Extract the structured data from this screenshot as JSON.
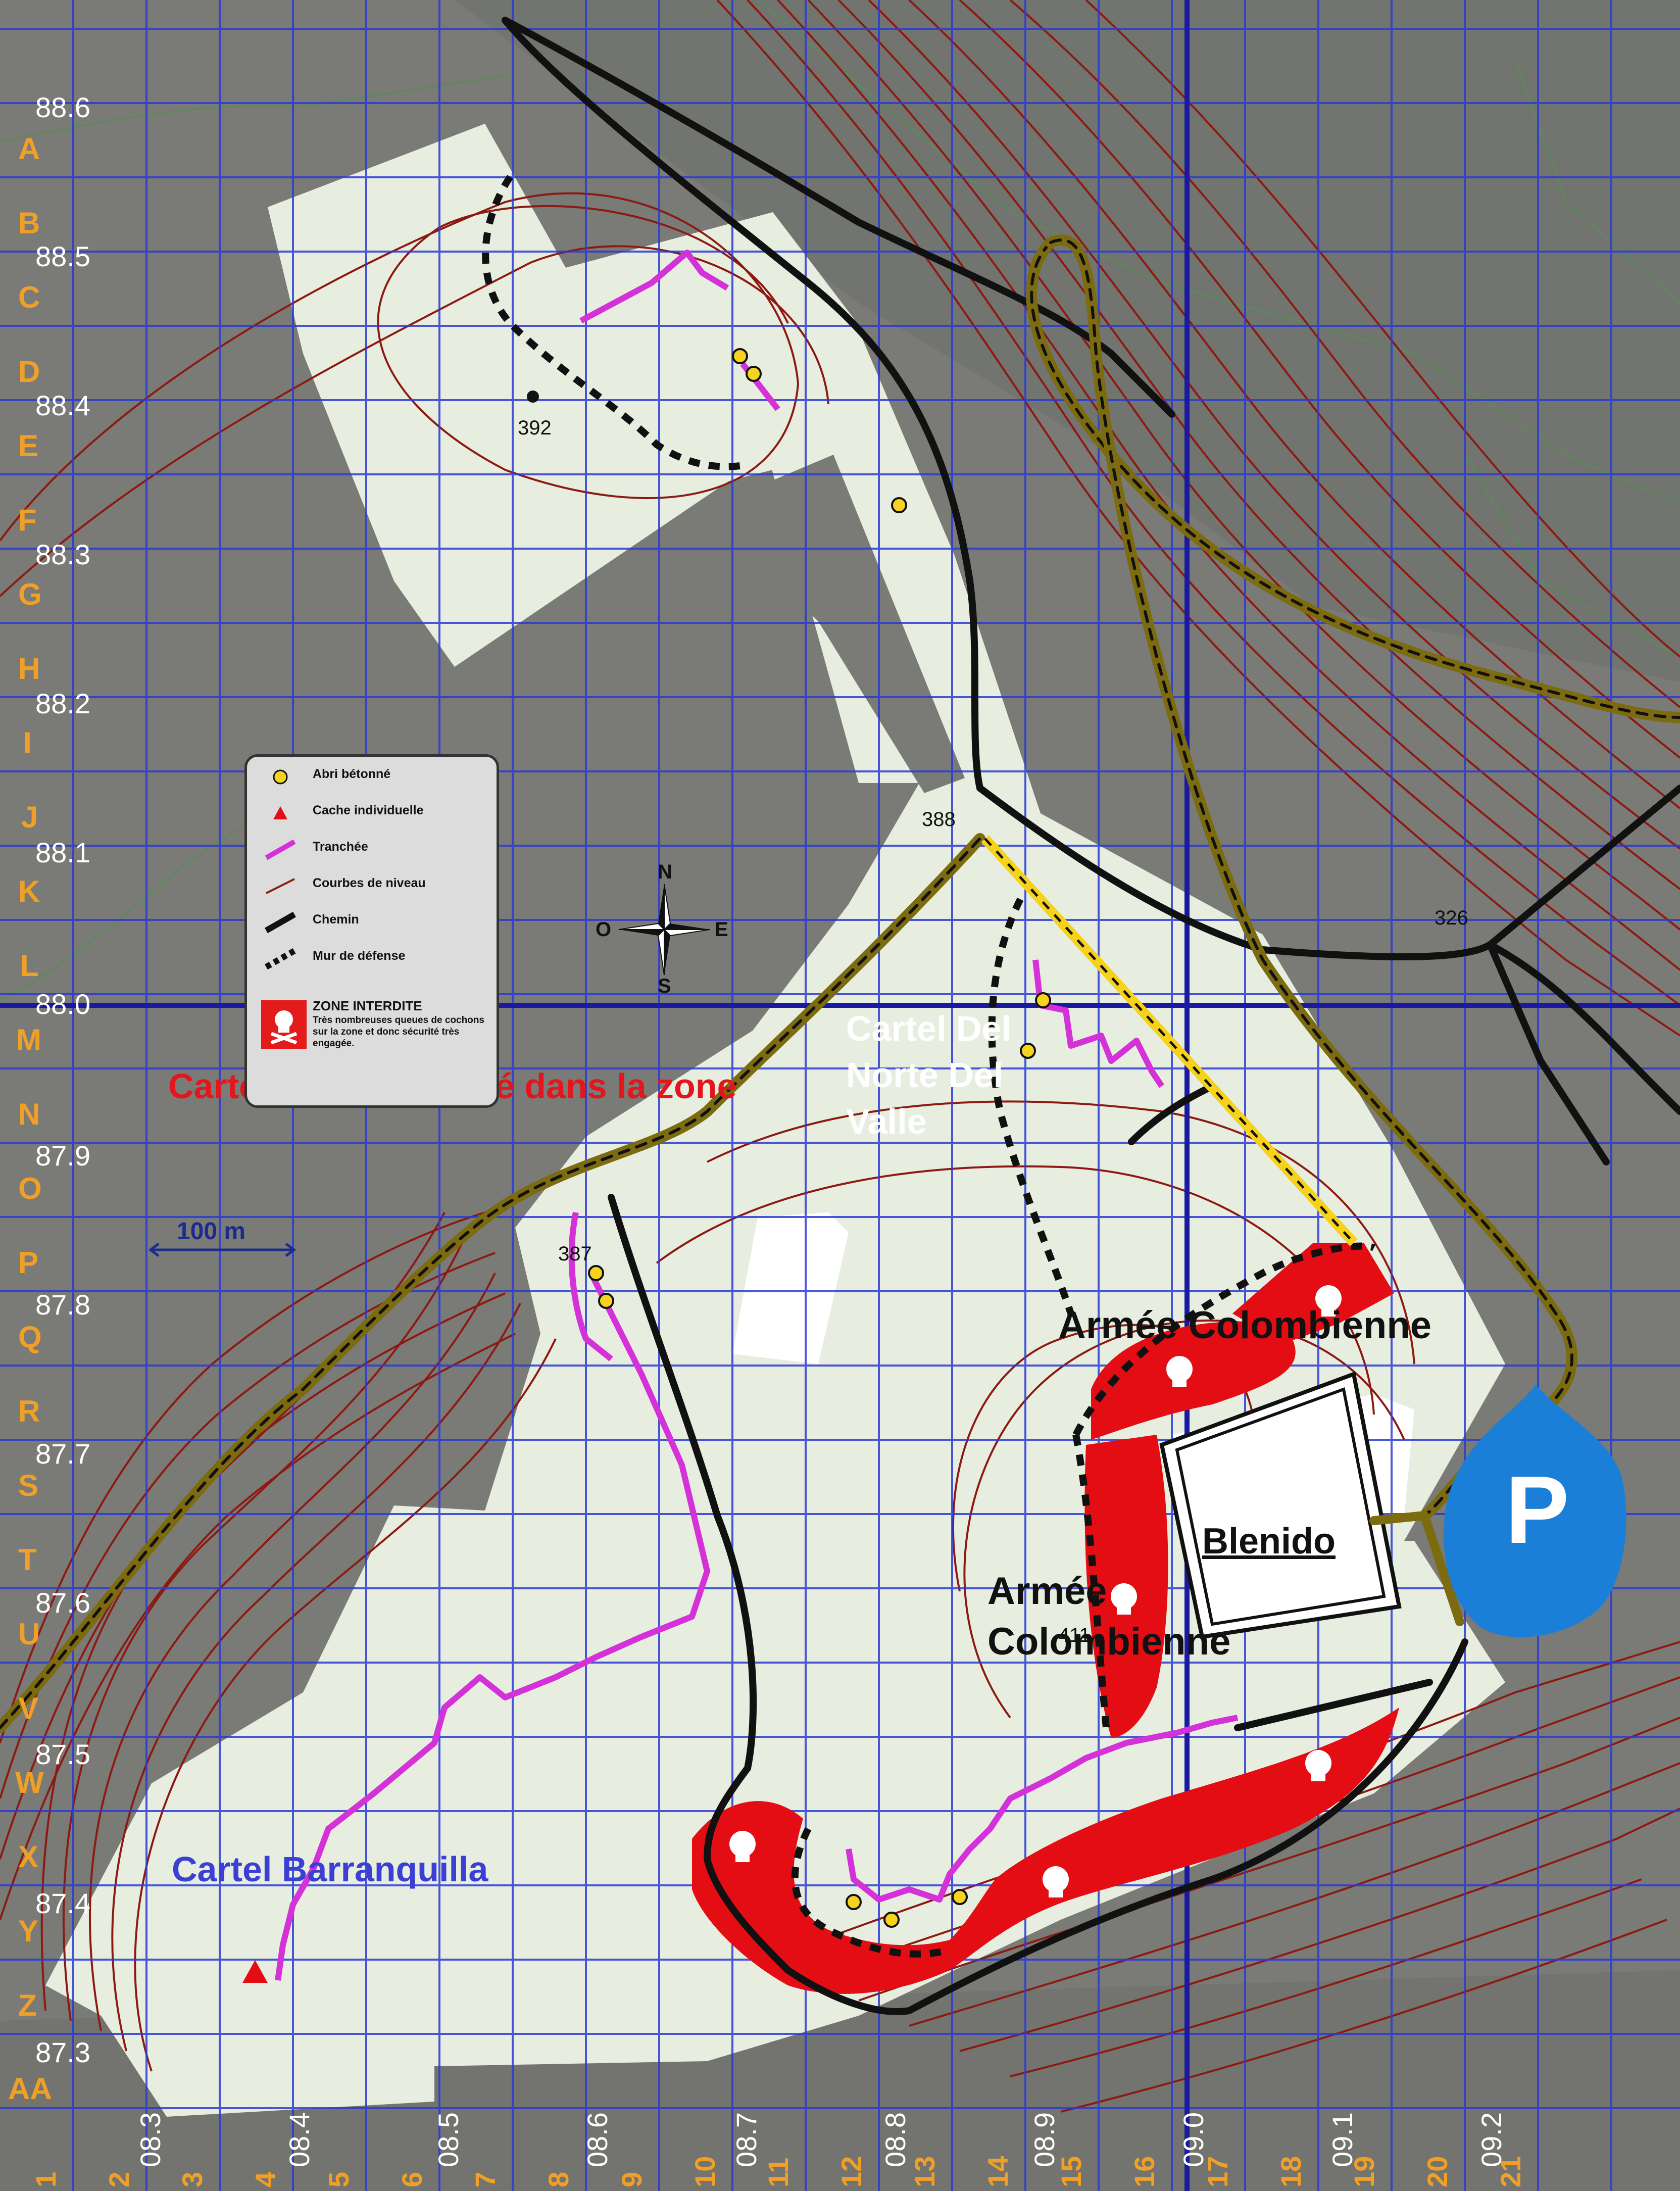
{
  "map": {
    "y_coords": [
      "88.6",
      "88.5",
      "88.4",
      "88.3",
      "88.2",
      "88.1",
      "88.0",
      "87.9",
      "87.8",
      "87.7",
      "87.6",
      "87.5",
      "87.4",
      "87.3"
    ],
    "x_coords": [
      "08.3",
      "08.4",
      "08.5",
      "08.6",
      "08.7",
      "08.8",
      "08.9",
      "09.0",
      "09.1",
      "09.2"
    ],
    "row_letters": [
      "A",
      "B",
      "C",
      "D",
      "E",
      "F",
      "G",
      "H",
      "I",
      "J",
      "K",
      "L",
      "M",
      "N",
      "O",
      "P",
      "Q",
      "R",
      "S",
      "T",
      "U",
      "V",
      "W",
      "X",
      "Y",
      "Z",
      "AA"
    ],
    "col_numbers": [
      "1",
      "2",
      "3",
      "4",
      "5",
      "6",
      "7",
      "8",
      "9",
      "10",
      "11",
      "12",
      "13",
      "14",
      "15",
      "16",
      "17",
      "18",
      "19",
      "20",
      "21"
    ],
    "spot_heights": {
      "h392": "392",
      "h388": "388",
      "h326": "326",
      "h387": "387",
      "h411": "411"
    }
  },
  "labels": {
    "jra": "Cartel JRA non situé dans la zone",
    "norte_del_valle": "Cartel Del Norte Del Valle",
    "barranquilla": "Cartel Barranquilla",
    "armee_top": "Armée Colombienne",
    "armee_mid": "Armée Colombienne",
    "blenido": "Blenido",
    "parking": "P"
  },
  "legend": {
    "items": [
      {
        "icon": "bunker-icon",
        "label": "Abri bétonné"
      },
      {
        "icon": "cache-icon",
        "label": "Cache individuelle"
      },
      {
        "icon": "trench-icon",
        "label": "Tranchée"
      },
      {
        "icon": "contour-icon",
        "label": "Courbes de niveau"
      },
      {
        "icon": "path-icon",
        "label": "Chemin"
      },
      {
        "icon": "wall-icon",
        "label": "Mur de défense"
      }
    ],
    "zone_title": "ZONE  INTERDITE",
    "zone_desc": "Très nombreuses queues de cochons sur la zone et donc sécurité très engagée."
  },
  "compass": {
    "n": "N",
    "s": "S",
    "e": "E",
    "o": "O"
  },
  "scale": {
    "label": "100 m"
  },
  "colors": {
    "background": "#7d7d78",
    "area": "#e8efe1",
    "grid": "#2a3bd6",
    "grid_major": "#1a1aa0",
    "contour": "#8c1a12",
    "trench": "#d531d8",
    "danger": "#e30d13",
    "road_gold": "#7d6b10",
    "road_yellow": "#f7d21a",
    "parking": "#1b7fd8",
    "bunker": "#f5d31f"
  }
}
